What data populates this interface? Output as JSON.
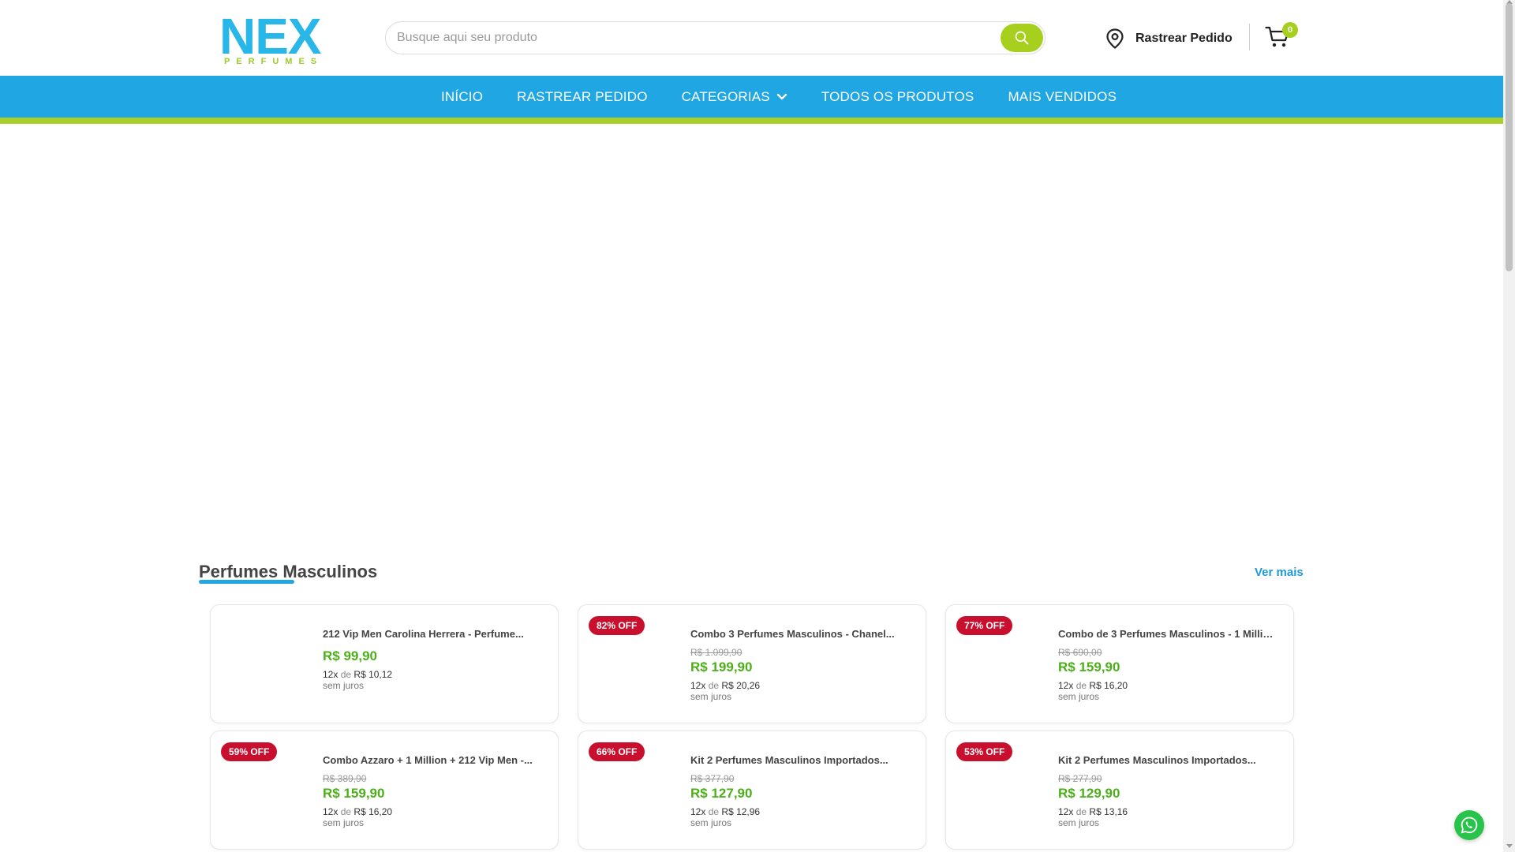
{
  "header": {
    "logo_main": "NEX",
    "logo_sub": "PERFUMES",
    "search_placeholder": "Busque aqui seu produto",
    "track_label": "Rastrear Pedido",
    "cart_count": "0"
  },
  "nav": {
    "items": [
      {
        "label": "INÍCIO"
      },
      {
        "label": "RASTREAR PEDIDO"
      },
      {
        "label": "CATEGORIAS"
      },
      {
        "label": "TODOS OS PRODUTOS"
      },
      {
        "label": "MAIS VENDIDOS"
      }
    ]
  },
  "section": {
    "title": "Perfumes Masculinos",
    "see_more": "Ver mais"
  },
  "products": [
    {
      "badge": "",
      "name": "212 Vip Men Carolina Herrera - Perfume...",
      "old_price": "",
      "price": "R$ 99,90",
      "inst_count": "12x",
      "inst_de": "de",
      "inst_value": "R$ 10,12",
      "no_fee": "sem juros"
    },
    {
      "badge": "82% OFF",
      "name": "Combo 3 Perfumes Masculinos - Chanel...",
      "old_price": "R$ 1.099,90",
      "price": "R$ 199,90",
      "inst_count": "12x",
      "inst_de": "de",
      "inst_value": "R$ 20,26",
      "no_fee": "sem juros"
    },
    {
      "badge": "77% OFF",
      "name": "Combo de 3 Perfumes Masculinos - 1 Millio...",
      "old_price": "R$ 690,00",
      "price": "R$ 159,90",
      "inst_count": "12x",
      "inst_de": "de",
      "inst_value": "R$ 16,20",
      "no_fee": "sem juros"
    },
    {
      "badge": "59% OFF",
      "name": "Combo Azzaro + 1 Million + 212 Vip Men -...",
      "old_price": "R$ 389,90",
      "price": "R$ 159,90",
      "inst_count": "12x",
      "inst_de": "de",
      "inst_value": "R$ 16,20",
      "no_fee": "sem juros"
    },
    {
      "badge": "66% OFF",
      "name": "Kit 2 Perfumes Masculinos Importados...",
      "old_price": "R$ 377,90",
      "price": "R$ 127,90",
      "inst_count": "12x",
      "inst_de": "de",
      "inst_value": "R$ 12,96",
      "no_fee": "sem juros"
    },
    {
      "badge": "53% OFF",
      "name": "Kit 2 Perfumes Masculinos Importados...",
      "old_price": "R$ 277,90",
      "price": "R$ 129,90",
      "inst_count": "12x",
      "inst_de": "de",
      "inst_value": "R$ 13,16",
      "no_fee": "sem juros"
    }
  ],
  "colors": {
    "brand_blue": "#20a7e3",
    "brand_green": "#a9d02a",
    "badge_red": "#c8102e",
    "price_green": "#4caf1a"
  },
  "icons": {
    "search": "search-icon",
    "location": "location-pin-icon",
    "cart": "cart-icon",
    "chevron": "chevron-down-icon",
    "whatsapp": "whatsapp-icon"
  }
}
